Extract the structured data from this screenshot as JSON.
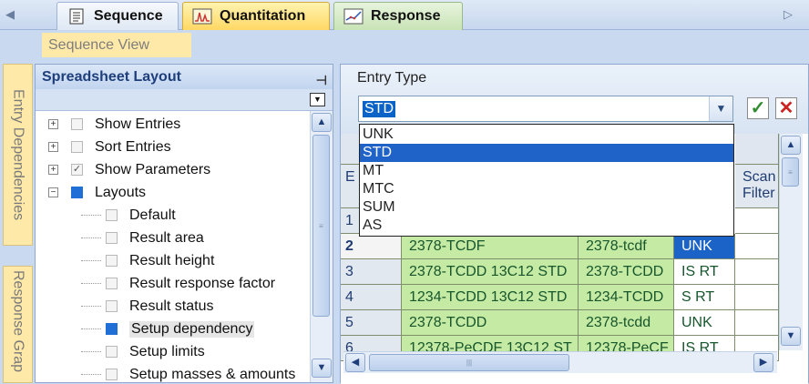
{
  "tabs": [
    {
      "label": "Sequence",
      "icon": "document-icon"
    },
    {
      "label": "Quantitation",
      "icon": "chromatogram-icon"
    },
    {
      "label": "Response",
      "icon": "response-chart-icon"
    }
  ],
  "subheader": {
    "label": "Sequence View"
  },
  "side_tabs": [
    "Entry Dependencies",
    "Response Grap"
  ],
  "left_panel": {
    "title": "Spreadsheet Layout",
    "tree": [
      {
        "label": "Show Entries"
      },
      {
        "label": "Sort Entries"
      },
      {
        "label": "Show Parameters"
      },
      {
        "label": "Layouts"
      },
      {
        "label": "Default"
      },
      {
        "label": "Result area"
      },
      {
        "label": "Result height"
      },
      {
        "label": "Result response factor"
      },
      {
        "label": "Result status"
      },
      {
        "label": "Setup dependency"
      },
      {
        "label": "Setup limits"
      },
      {
        "label": "Setup masses & amounts"
      }
    ]
  },
  "entry_type": {
    "label": "Entry Type",
    "selected": "STD",
    "options": [
      "UNK",
      "STD",
      "MT",
      "MTC",
      "SUM",
      "AS"
    ]
  },
  "grid": {
    "header_partial": [
      "E",
      "Scan",
      "Filter"
    ],
    "rows": [
      {
        "num": "1",
        "name": "",
        "short": "",
        "type": ""
      },
      {
        "num": "2",
        "name": "2378-TCDF",
        "short": "2378-tcdf",
        "type": "UNK"
      },
      {
        "num": "3",
        "name": "2378-TCDD 13C12 STD",
        "short": "2378-TCDD",
        "type": "IS RT"
      },
      {
        "num": "4",
        "name": "1234-TCDD 13C12 STD",
        "short": "1234-TCDD",
        "type": "S RT"
      },
      {
        "num": "5",
        "name": "2378-TCDD",
        "short": "2378-tcdd",
        "type": "UNK"
      },
      {
        "num": "6",
        "name": "12378-PeCDF 13C12 ST",
        "short": "12378-PeCF",
        "type": "IS RT"
      }
    ]
  },
  "colors": {
    "accent": "#1f63c9",
    "row_green": "#c5eaa3",
    "tab_active": "#ffd864"
  }
}
